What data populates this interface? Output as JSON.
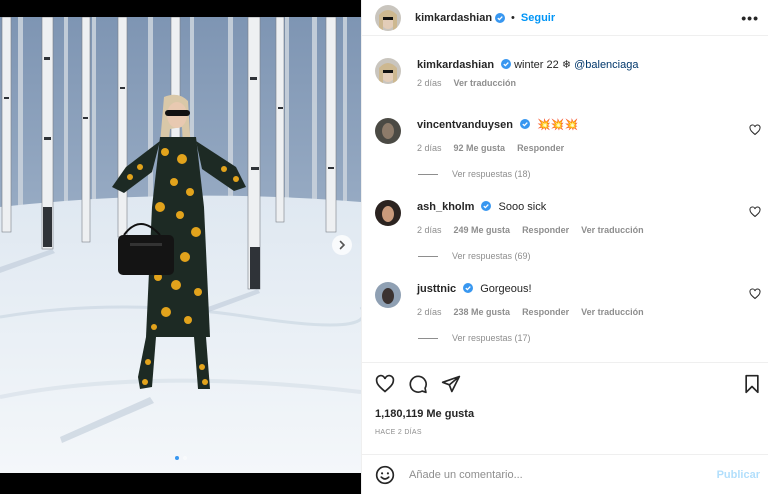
{
  "post": {
    "author": "kimkardashian",
    "follow_label": "Seguir",
    "separator": "•",
    "more_label": "•••",
    "media_dots": 2,
    "active_dot": 1
  },
  "caption": {
    "username": "kimkardashian",
    "text": "winter 22",
    "emoji": "❄",
    "mention": "@balenciaga",
    "age": "2 días",
    "translate_label": "Ver traducción"
  },
  "comments": [
    {
      "username": "vincentvanduysen",
      "text": "💥💥💥",
      "age": "2 días",
      "likes": "92 Me gusta",
      "reply_label": "Responder",
      "translate_label": "",
      "replies_label": "Ver respuestas (18)"
    },
    {
      "username": "ash_kholm",
      "text": "Sooo sick",
      "age": "2 días",
      "likes": "249 Me gusta",
      "reply_label": "Responder",
      "translate_label": "Ver traducción",
      "replies_label": "Ver respuestas (69)"
    },
    {
      "username": "justtnic",
      "text": "Gorgeous!",
      "age": "2 días",
      "likes": "238 Me gusta",
      "reply_label": "Responder",
      "translate_label": "Ver traducción",
      "replies_label": "Ver respuestas (17)"
    }
  ],
  "stats": {
    "likes": "1,180,119 Me gusta",
    "posted": "HACE 2 DÍAS"
  },
  "composer": {
    "placeholder": "Añade un comentario...",
    "publish_label": "Publicar"
  },
  "colors": {
    "accent": "#0095f6",
    "verified": "#3897f0",
    "muted": "#8e8e8e",
    "publish_disabled": "#b2dffc"
  }
}
